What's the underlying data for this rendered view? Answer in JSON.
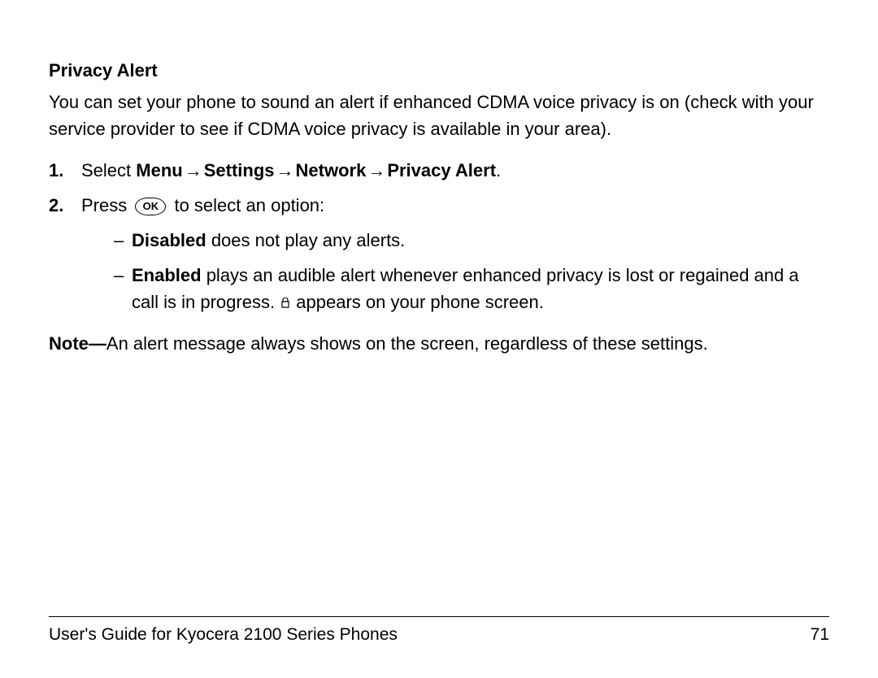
{
  "heading": "Privacy Alert",
  "intro": "You can set your phone to sound an alert if enhanced CDMA voice privacy is on (check with your service provider to see if CDMA voice privacy is available in your area).",
  "steps": {
    "s1_num": "1.",
    "s1_pre": "Select ",
    "s1_menu": "Menu",
    "s1_settings": "Settings",
    "s1_network": "Network",
    "s1_privacy": "Privacy Alert",
    "s1_period": ".",
    "arrow": "→",
    "s2_num": "2.",
    "s2_pre": "Press ",
    "s2_ok": "OK",
    "s2_post": " to select an option:",
    "d1_dash": "–",
    "d1_bold": "Disabled",
    "d1_rest": " does not play any alerts.",
    "d2_dash": "–",
    "d2_bold": "Enabled",
    "d2_rest_a": " plays an audible alert whenever enhanced privacy is lost or regained and a call is in progress. ",
    "d2_rest_b": " appears on your phone screen."
  },
  "note_label": "Note—",
  "note_text": "An alert message always shows on the screen, regardless of these settings.",
  "footer_title": "User's Guide for Kyocera 2100 Series Phones",
  "footer_page": "71"
}
